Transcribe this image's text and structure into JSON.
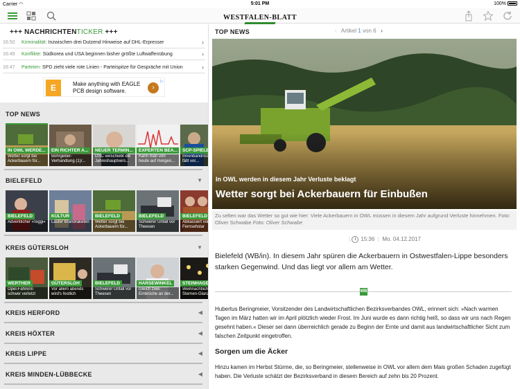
{
  "status": {
    "carrier": "Carrier",
    "time": "5:01 PM",
    "battery": "100%"
  },
  "navbar": {
    "logo": "WESTFALEN-BLATT"
  },
  "ticker": {
    "title_a": "+++ NACHRICHTEN",
    "title_b": "TICKER",
    "title_c": " +++",
    "items": [
      {
        "time": "16:50",
        "category": "Kriminalität:",
        "text": " Inzwischen drei Dutzend Hinweise auf DHL-Erpresser"
      },
      {
        "time": "16:49",
        "category": "Konflikte:",
        "text": " Südkorea und USA beginnen bisher größte Luftwaffenübung"
      },
      {
        "time": "16:47",
        "category": "Parteien:",
        "text": " SPD zieht viele rote Linien - Parteispitze für Gespräche mit Union"
      }
    ]
  },
  "ad": {
    "text_line1": "Make anything with EAGLE",
    "text_line2": "PCB design software.",
    "logo": "E"
  },
  "sections": {
    "top_news": {
      "title": "TOP NEWS",
      "tiles": [
        {
          "badge": "IN OWL WERDE...",
          "caption": "Wetter sorgt bei Ackerbauern für..."
        },
        {
          "badge": "EIN RICHTER A...",
          "caption": "Bohrgeber-Verhandlung (1)/..."
        },
        {
          "badge": "NEUER TERMIN...",
          "caption": "DSC verschiebt die Jahreshauptvers..."
        },
        {
          "badge": "EXPERTEN BEA...",
          "caption": "Kann man von heute auf morgen..."
        },
        {
          "badge": "SCP-SPIELE...",
          "caption": "Innenbandriss Ritter fällt vor..."
        }
      ]
    },
    "bielefeld": {
      "title": "BIELEFELD",
      "tiles": [
        {
          "badge": "BIELEFELD",
          "caption": "Adventlicher »Siggi«"
        },
        {
          "badge": "KULTUR",
          "caption": "Lauter Brandraketen"
        },
        {
          "badge": "BIELEFELD",
          "caption": "Wetter sorgt bei Ackerbauern für..."
        },
        {
          "badge": "BIELEFELD",
          "caption": "Schwerer Unfall vor Theesen"
        },
        {
          "badge": "BIELEFELD",
          "caption": "Abkassiert vor Fernsehstar"
        }
      ]
    },
    "guetersloh": {
      "title": "KREIS GÜTERSLOH",
      "tiles": [
        {
          "badge": "WERTHER",
          "caption": "Opel-Fahrerin schwer verletzt"
        },
        {
          "badge": "GÜTERSLOH",
          "caption": "Vor allem abends wird's festlich"
        },
        {
          "badge": "BIELEFELD",
          "caption": "Schwerer Unfall vor Theesen"
        },
        {
          "badge": "HARSEWINKEL",
          "caption": "Gleich zwei Einbrüche an der..."
        },
        {
          "badge": "STEINHAGEN",
          "caption": "Weihnachtlicher Sternen-Glanz"
        }
      ]
    },
    "collapsed": [
      "KREIS HERFORD",
      "KREIS HÖXTER",
      "KREIS LIPPE",
      "KREIS MINDEN-LÜBBECKE"
    ]
  },
  "article": {
    "section_title": "TOP NEWS",
    "pager_prefix": "Artikel ",
    "pager_current": "1",
    "pager_suffix": " von 6",
    "kicker": "In OWL werden in diesem Jahr Verluste beklagt",
    "headline": "Wetter sorgt bei Ackerbauern für Einbußen",
    "caption": "Zu selten war das Wetter so gut wie hier: Viele Ackerbauern in OWL müssen in diesem Jahr aufgrund Verluste hinnehmen. Foto: Oliver Schwabe ",
    "photo_credit": "Foto: Oliver Schwabe",
    "time": "15:36",
    "date": "Mo. 04.12.2017",
    "lead": "Bielefeld (WB/in). In diesem Jahr spüren die Ackerbauern in Ostwestfalen-Lippe besonders starken Gegenwind. Und das liegt vor allem am Wetter.",
    "separator_mark": "WB",
    "body1": "Hubertus Beringmeier, Vorsitzender des Landwirtschaftlichen Bezirksverbandes OWL, erinnert sich: »Nach warmen Tagen im März hatten wir im April plötzlich wieder Frost. Im Juni wurde es dann richtig heiß, so dass wir uns nach Regen gesehnt haben.« Dieser sei dann überreichlich gerade zu Beginn der Ernte und damit aus landwirtschaftlicher Sicht zum falschen Zeitpunkt eingetroffen.",
    "subheading": "Sorgen um die Äcker",
    "body2": "Hinzu kamen im Herbst Stürme, die, so Beringmeier, stellenweise in OWL vor allem dem Mais großen Schaden zugefügt haben. Die Verluste schätzt der Bezirksverband in diesem Bereich auf zehn bis 20 Prozent."
  },
  "colors": {
    "accent": "#3a9a3a",
    "link": "#3a7ac0"
  }
}
